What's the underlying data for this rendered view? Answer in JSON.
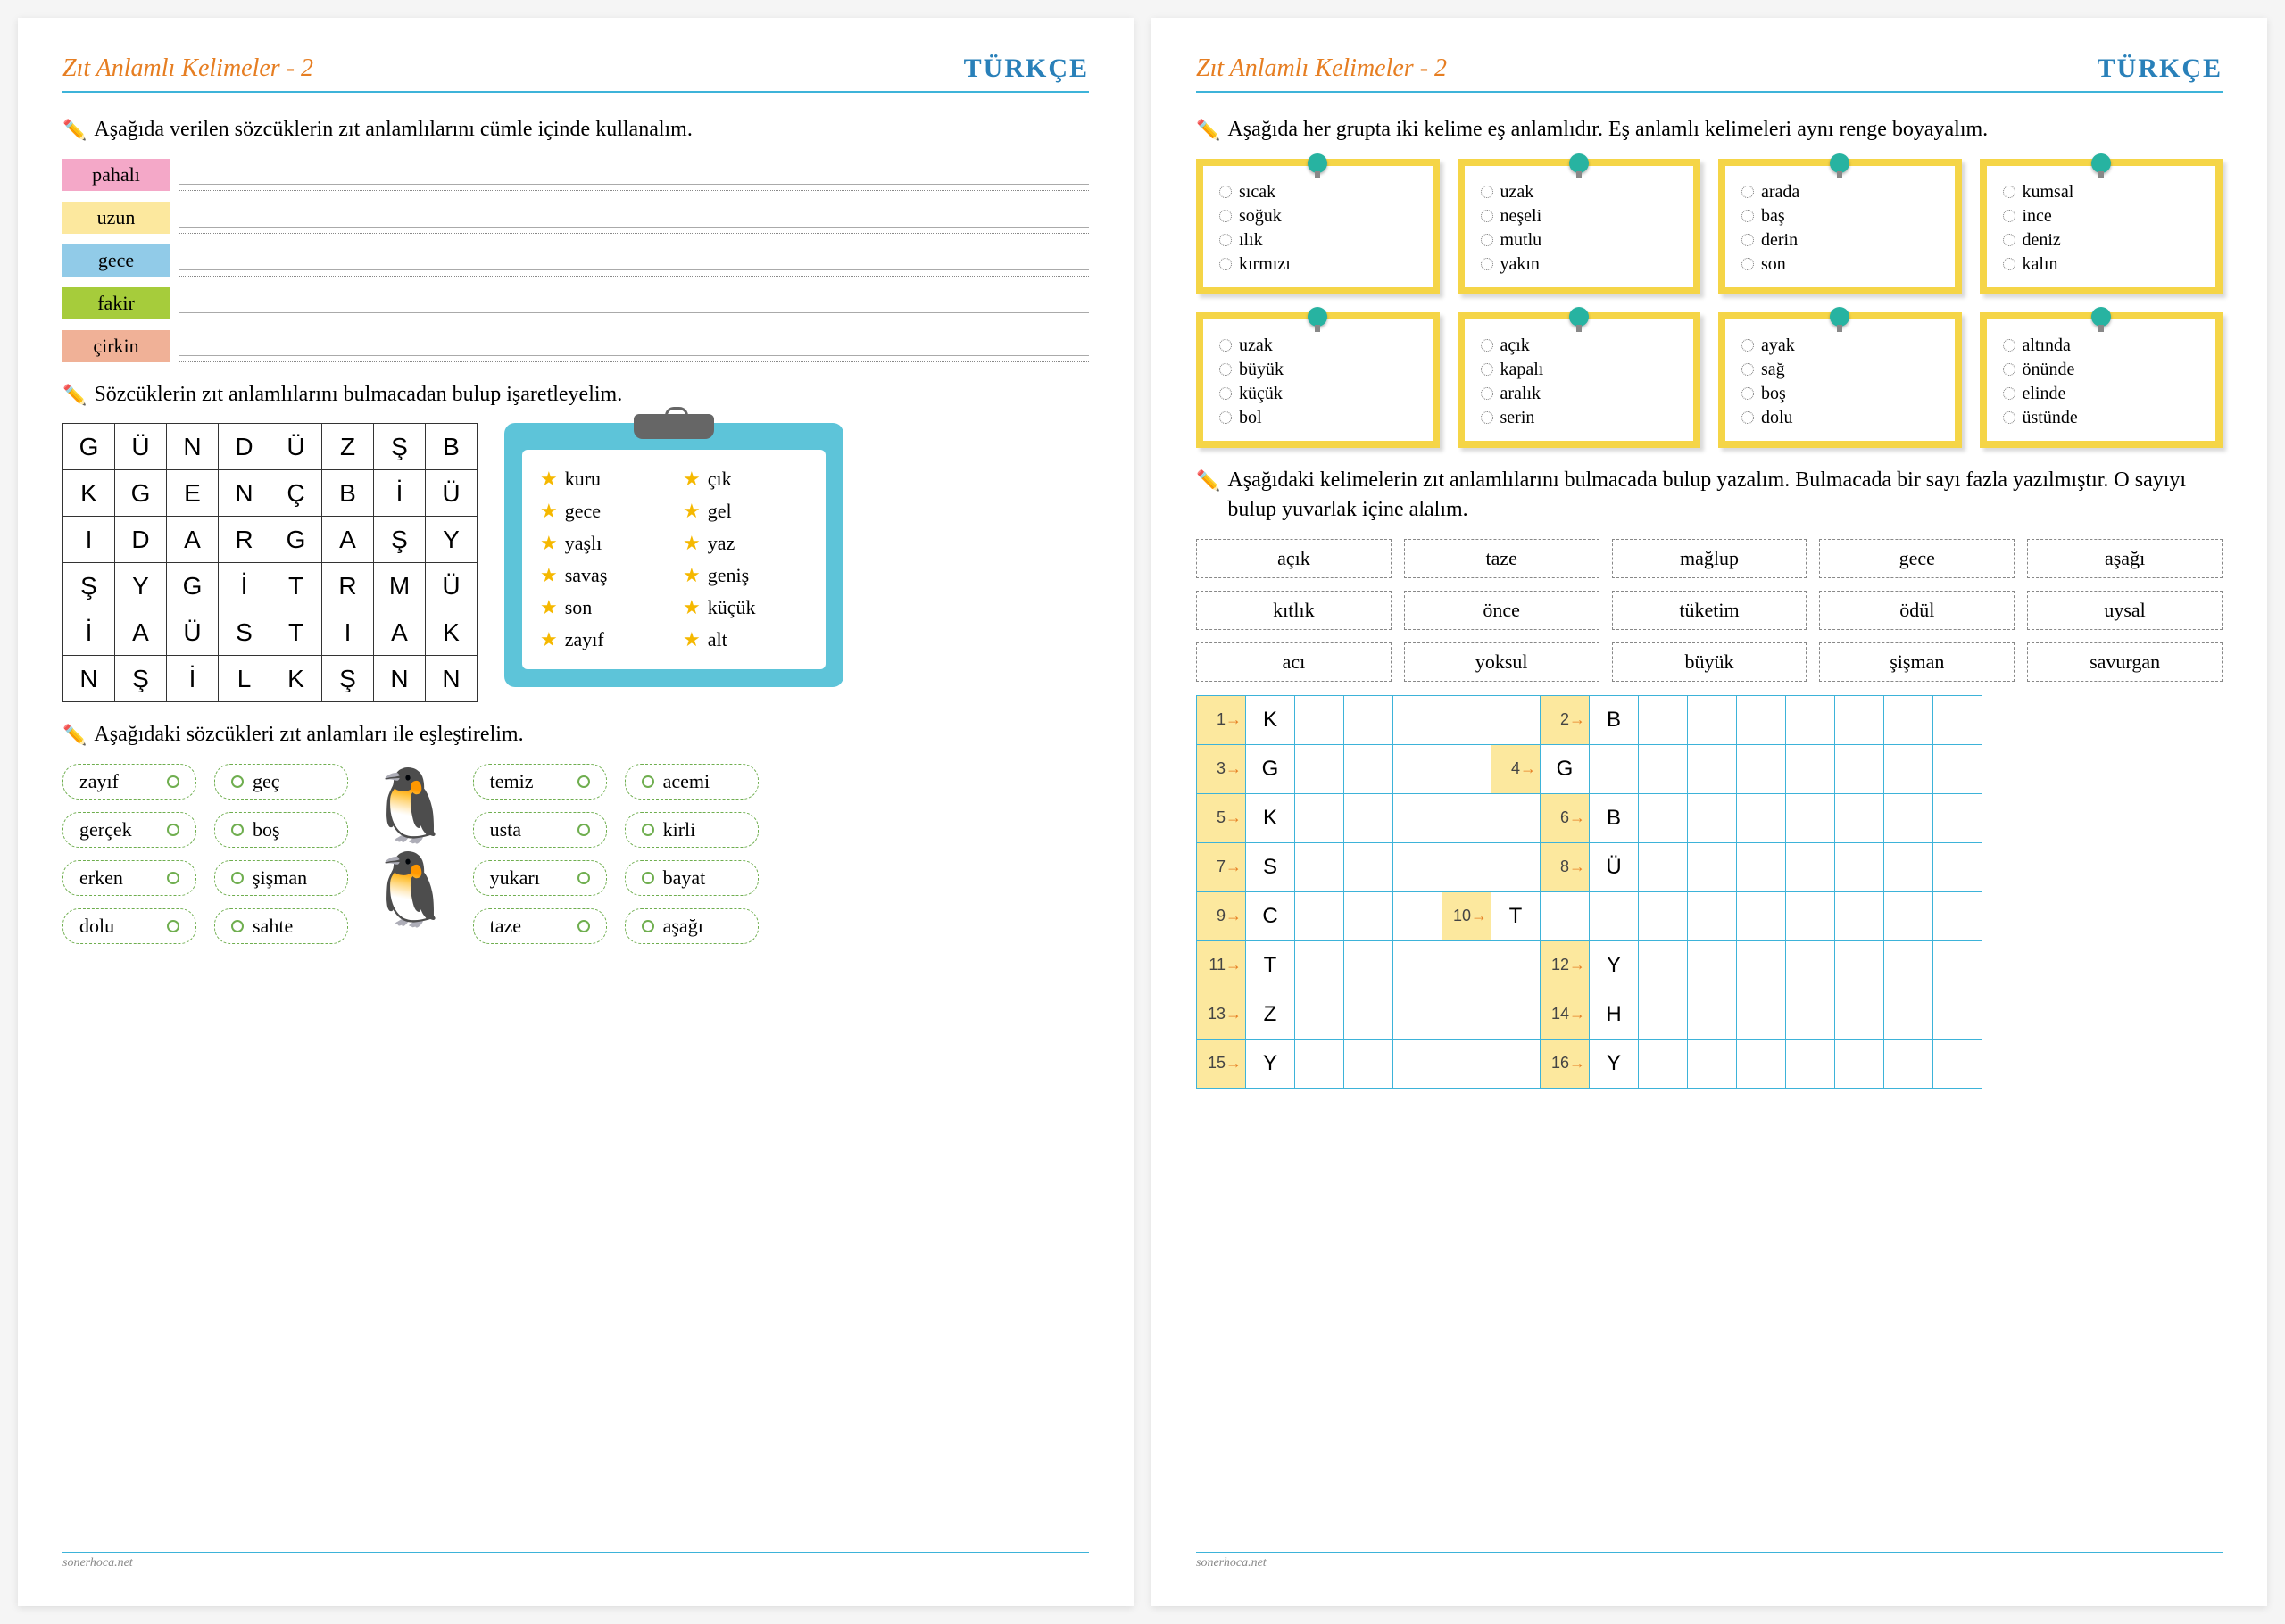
{
  "header": {
    "title": "Zıt Anlamlı Kelimeler - 2",
    "subject": "TÜRKÇE"
  },
  "footer": "sonerhoca.net",
  "left": {
    "ex1_instruction": "Aşağıda verilen sözcüklerin zıt anlamlılarını cümle içinde kullanalım.",
    "ex1_words": [
      "pahalı",
      "uzun",
      "gece",
      "fakir",
      "çirkin"
    ],
    "ex2_instruction": "Sözcüklerin zıt anlamlılarını bulmacadan bulup işaretleyelim.",
    "wordsearch": [
      [
        "G",
        "Ü",
        "N",
        "D",
        "Ü",
        "Z",
        "Ş",
        "B"
      ],
      [
        "K",
        "G",
        "E",
        "N",
        "Ç",
        "B",
        "İ",
        "Ü"
      ],
      [
        "I",
        "D",
        "A",
        "R",
        "G",
        "A",
        "Ş",
        "Y"
      ],
      [
        "Ş",
        "Y",
        "G",
        "İ",
        "T",
        "R",
        "M",
        "Ü"
      ],
      [
        "İ",
        "A",
        "Ü",
        "S",
        "T",
        "I",
        "A",
        "K"
      ],
      [
        "N",
        "Ş",
        "İ",
        "L",
        "K",
        "Ş",
        "N",
        "N"
      ]
    ],
    "clip_words": [
      [
        "kuru",
        "çık"
      ],
      [
        "gece",
        "gel"
      ],
      [
        "yaşlı",
        "yaz"
      ],
      [
        "savaş",
        "geniş"
      ],
      [
        "son",
        "küçük"
      ],
      [
        "zayıf",
        "alt"
      ]
    ],
    "ex3_instruction": "Aşağıdaki sözcükleri zıt anlamları ile eşleştirelim.",
    "match_left_a": [
      "zayıf",
      "gerçek",
      "erken",
      "dolu"
    ],
    "match_left_b": [
      "geç",
      "boş",
      "şişman",
      "sahte"
    ],
    "match_right_a": [
      "temiz",
      "usta",
      "yukarı",
      "taze"
    ],
    "match_right_b": [
      "acemi",
      "kirli",
      "bayat",
      "aşağı"
    ]
  },
  "right": {
    "ex1_instruction": "Aşağıda her grupta iki kelime eş anlamlıdır. Eş anlamlı kelimeleri aynı renge boyayalım.",
    "notes": [
      [
        "sıcak",
        "soğuk",
        "ılık",
        "kırmızı"
      ],
      [
        "uzak",
        "neşeli",
        "mutlu",
        "yakın"
      ],
      [
        "arada",
        "baş",
        "derin",
        "son"
      ],
      [
        "kumsal",
        "ince",
        "deniz",
        "kalın"
      ],
      [
        "uzak",
        "büyük",
        "küçük",
        "bol"
      ],
      [
        "açık",
        "kapalı",
        "aralık",
        "serin"
      ],
      [
        "ayak",
        "sağ",
        "boş",
        "dolu"
      ],
      [
        "altında",
        "önünde",
        "elinde",
        "üstünde"
      ]
    ],
    "ex2_instruction": "Aşağıdaki kelimelerin zıt anlamlılarını bulmacada bulup yazalım. Bulmacada bir sayı fazla yazılmıştır. O sayıyı bulup yuvarlak içine alalım.",
    "dashed_words": [
      "açık",
      "taze",
      "mağlup",
      "gece",
      "aşağı",
      "kıtlık",
      "önce",
      "tüketim",
      "ödül",
      "uysal",
      "acı",
      "yoksul",
      "büyük",
      "şişman",
      "savurgan"
    ],
    "crossword": {
      "cols": 16,
      "rows": 8,
      "clues": [
        {
          "r": 0,
          "c": 0,
          "n": "1",
          "l": "K"
        },
        {
          "r": 0,
          "c": 7,
          "n": "2",
          "l": "B"
        },
        {
          "r": 1,
          "c": 0,
          "n": "3",
          "l": "G"
        },
        {
          "r": 1,
          "c": 6,
          "n": "4",
          "l": "G"
        },
        {
          "r": 2,
          "c": 0,
          "n": "5",
          "l": "K"
        },
        {
          "r": 2,
          "c": 7,
          "n": "6",
          "l": "B"
        },
        {
          "r": 3,
          "c": 0,
          "n": "7",
          "l": "S"
        },
        {
          "r": 3,
          "c": 7,
          "n": "8",
          "l": "Ü"
        },
        {
          "r": 4,
          "c": 0,
          "n": "9",
          "l": "C"
        },
        {
          "r": 4,
          "c": 5,
          "n": "10",
          "l": "T"
        },
        {
          "r": 5,
          "c": 0,
          "n": "11",
          "l": "T"
        },
        {
          "r": 5,
          "c": 7,
          "n": "12",
          "l": "Y"
        },
        {
          "r": 6,
          "c": 0,
          "n": "13",
          "l": "Z"
        },
        {
          "r": 6,
          "c": 7,
          "n": "14",
          "l": "H"
        },
        {
          "r": 7,
          "c": 0,
          "n": "15",
          "l": "Y"
        },
        {
          "r": 7,
          "c": 7,
          "n": "16",
          "l": "Y"
        }
      ]
    }
  }
}
